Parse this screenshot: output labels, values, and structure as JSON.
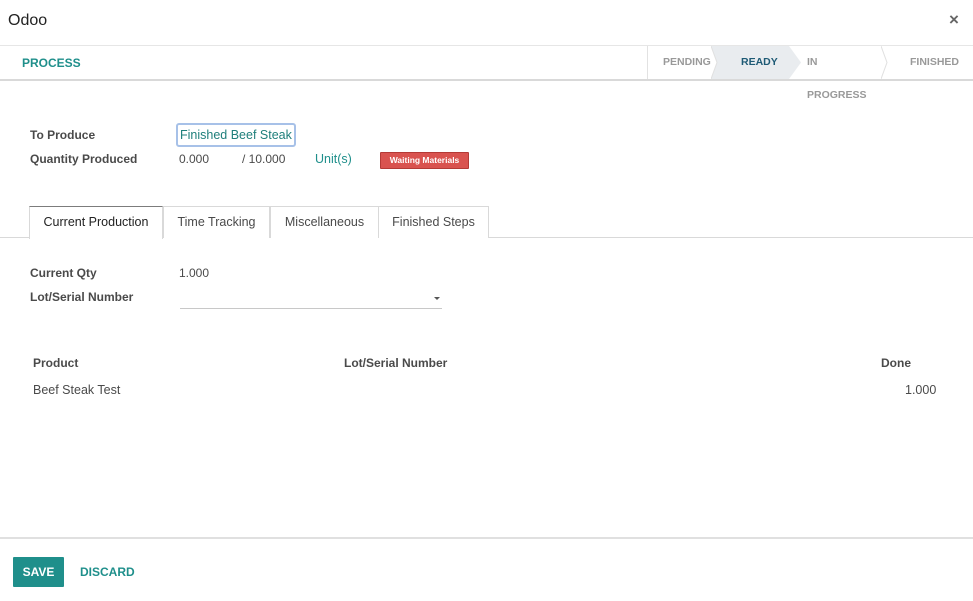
{
  "window": {
    "title": "Odoo",
    "close_glyph": "×"
  },
  "statusbar": {
    "process_label": "PROCESS",
    "stages": [
      {
        "label": "PENDING",
        "active": false
      },
      {
        "label": "READY",
        "active": true
      },
      {
        "label": "IN PROGRESS",
        "active": false
      },
      {
        "label": "FINISHED",
        "active": false
      }
    ]
  },
  "form": {
    "to_produce_label": "To Produce",
    "to_produce_value": "Finished Beef Steak",
    "qty_produced_label": "Quantity Produced",
    "qty_produced_value": "0.000",
    "qty_total": "/ 10.000",
    "unit": "Unit(s)",
    "status_badge": "Waiting Materials"
  },
  "tabs": [
    {
      "label": "Current Production",
      "active": true
    },
    {
      "label": "Time Tracking",
      "active": false
    },
    {
      "label": "Miscellaneous",
      "active": false
    },
    {
      "label": "Finished Steps",
      "active": false
    }
  ],
  "current_production": {
    "current_qty_label": "Current Qty",
    "current_qty_value": "1.000",
    "lot_label": "Lot/Serial Number",
    "lot_value": ""
  },
  "lines_table": {
    "headers": {
      "product": "Product",
      "lot": "Lot/Serial Number",
      "done": "Done"
    },
    "rows": [
      {
        "product": "Beef Steak Test",
        "lot": "",
        "done": "1.000"
      }
    ]
  },
  "footer": {
    "save_label": "SAVE",
    "discard_label": "DISCARD"
  },
  "colors": {
    "accent": "#1f8f8b",
    "badge_danger": "#d9534f",
    "active_stage_bg": "#e9ecef",
    "active_stage_text": "#1e5a75"
  },
  "icons": {
    "close": "close-icon",
    "dropdown": "caret-down-icon"
  }
}
